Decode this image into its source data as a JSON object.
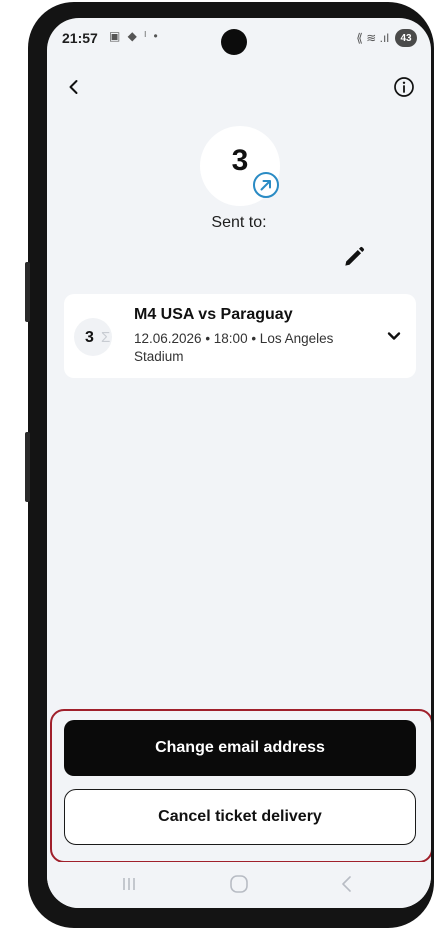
{
  "status_bar": {
    "time": "21:57",
    "left_icons": "▣ ◆ ˡ •",
    "signal_icons": "⟪ ≋ .ıl",
    "battery": "43"
  },
  "header": {
    "back_icon": "chevron-left-icon",
    "info_icon": "info-circle-icon"
  },
  "summary": {
    "ticket_count": "3",
    "sent_icon": "arrow-up-right-circle-icon",
    "sent_to_label": "Sent to:",
    "edit_icon": "pencil-icon"
  },
  "ticket": {
    "quantity": "3",
    "quantity_glyph": "Σ",
    "title": "M4 USA vs Paraguay",
    "details": "12.06.2026 • 18:00 • Los Angeles Stadium",
    "expand_icon": "chevron-down-icon"
  },
  "actions": {
    "primary_label": "Change email address",
    "secondary_label": "Cancel ticket delivery",
    "highlight_color": "#a0202b"
  },
  "colors": {
    "accent": "#2a8bc4",
    "background": "#f2f4f7",
    "primary_button": "#0a0a0a"
  }
}
